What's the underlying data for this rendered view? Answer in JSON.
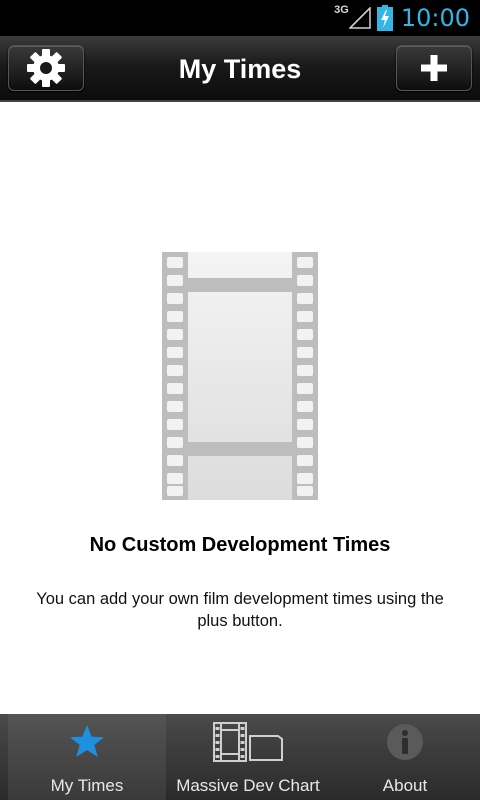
{
  "status_bar": {
    "network": "3G",
    "time": "10:00",
    "icons": [
      "signal-icon",
      "battery-charging-icon"
    ]
  },
  "action_bar": {
    "title": "My Times",
    "left_button_icon": "gear-icon",
    "right_button_icon": "plus-icon"
  },
  "empty_state": {
    "image": "film-strip-icon",
    "title": "No Custom Development Times",
    "description": "You can add your own film development times using the plus button."
  },
  "tabs": [
    {
      "label": "My Times",
      "icon": "star-icon",
      "active": true
    },
    {
      "label": "Massive Dev Chart",
      "icon": "film-tank-icon",
      "active": false
    },
    {
      "label": "About",
      "icon": "info-icon",
      "active": false
    }
  ],
  "colors": {
    "accent": "#33b5e5",
    "status_bar": "#000000",
    "content_bg": "#ffffff"
  }
}
